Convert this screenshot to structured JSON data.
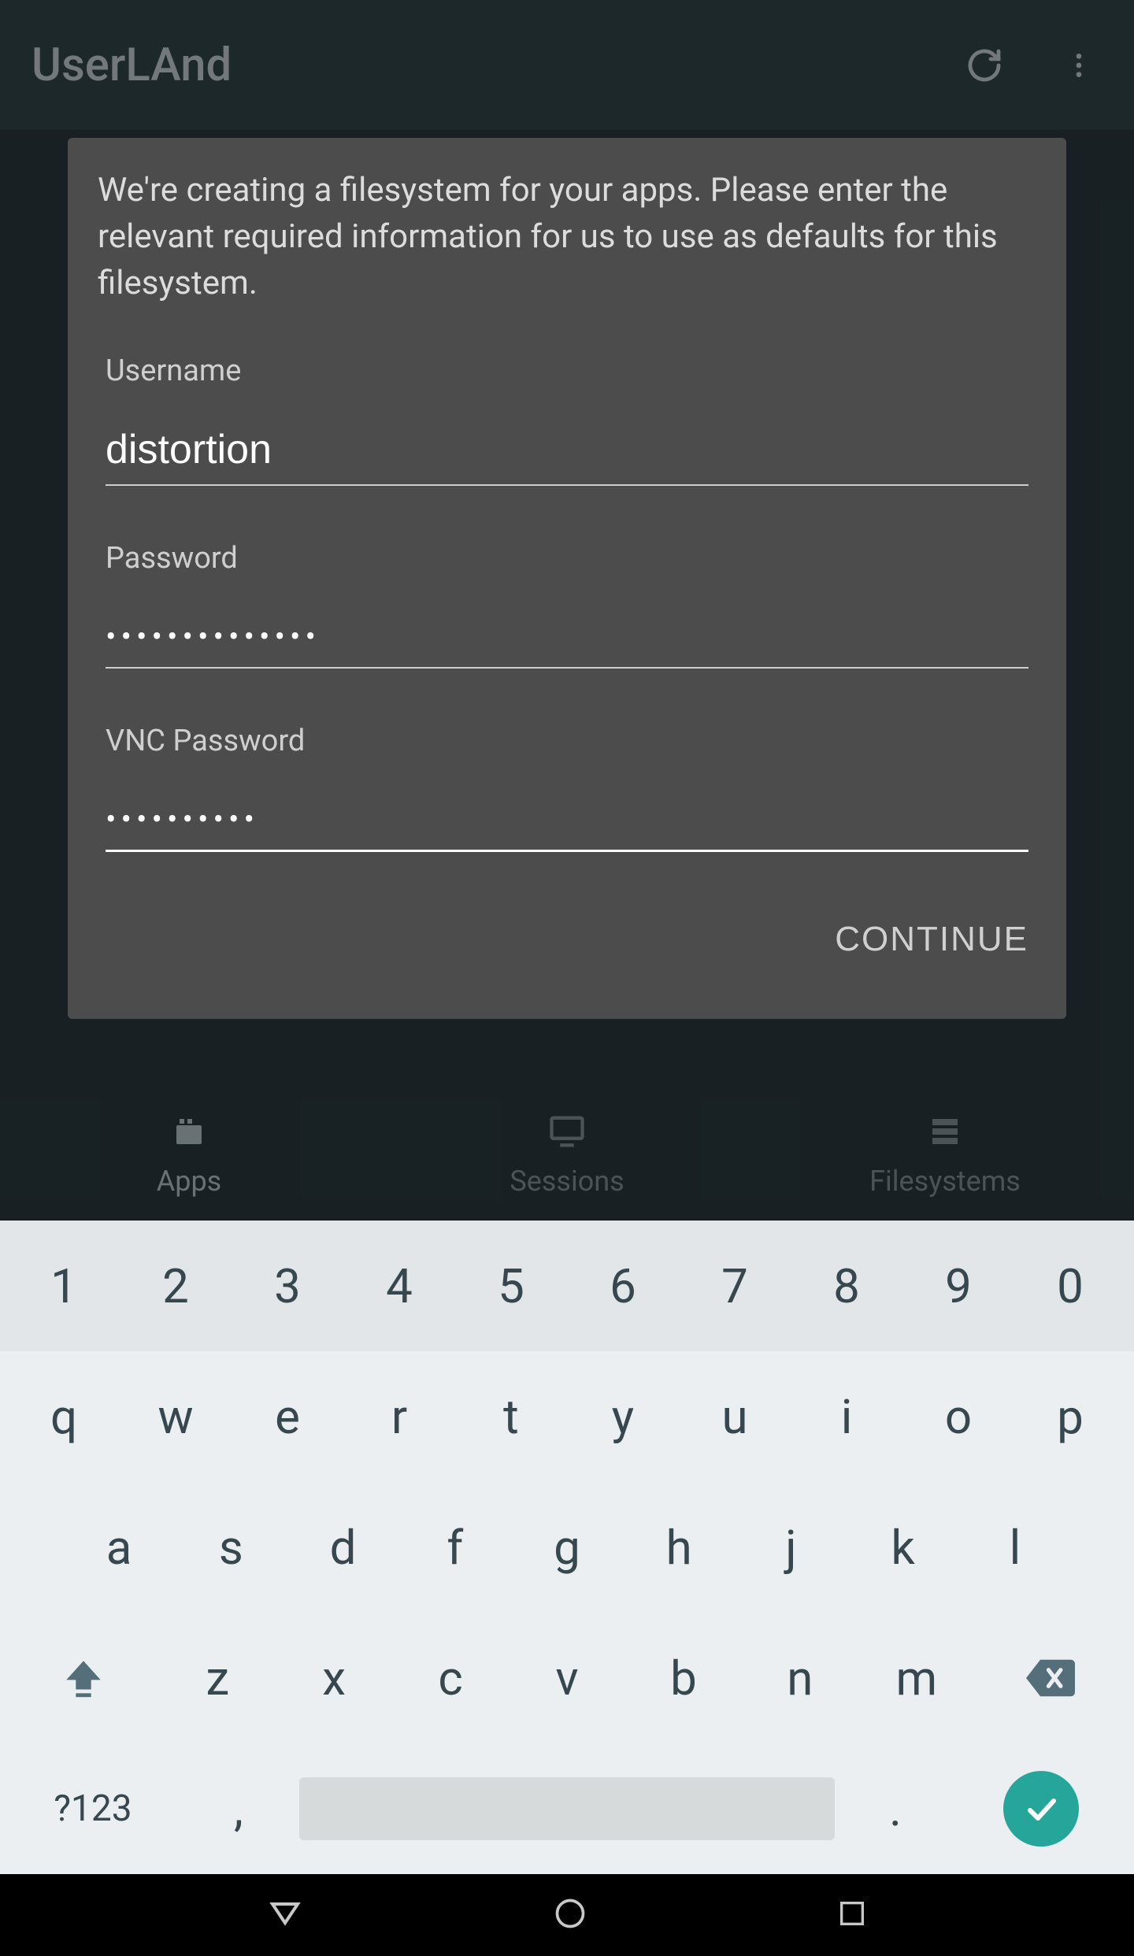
{
  "appbar": {
    "title": "UserLAnd"
  },
  "dialog": {
    "description": "We're creating a filesystem for your apps. Please enter the relevant required information for us to use as defaults for this filesystem.",
    "username_label": "Username",
    "username_value": "distortion",
    "password_label": "Password",
    "password_mask": "••••••••••••••",
    "vnc_label": "VNC Password",
    "vnc_mask": "••••••••••",
    "continue": "CONTINUE"
  },
  "tabs": {
    "apps": "Apps",
    "sessions": "Sessions",
    "filesystems": "Filesystems"
  },
  "keyboard": {
    "row_num": [
      "1",
      "2",
      "3",
      "4",
      "5",
      "6",
      "7",
      "8",
      "9",
      "0"
    ],
    "row1": [
      "q",
      "w",
      "e",
      "r",
      "t",
      "y",
      "u",
      "i",
      "o",
      "p"
    ],
    "row2": [
      "a",
      "s",
      "d",
      "f",
      "g",
      "h",
      "j",
      "k",
      "l"
    ],
    "row3": [
      "z",
      "x",
      "c",
      "v",
      "b",
      "n",
      "m"
    ],
    "sym": "?123",
    "comma": ",",
    "period": "."
  }
}
